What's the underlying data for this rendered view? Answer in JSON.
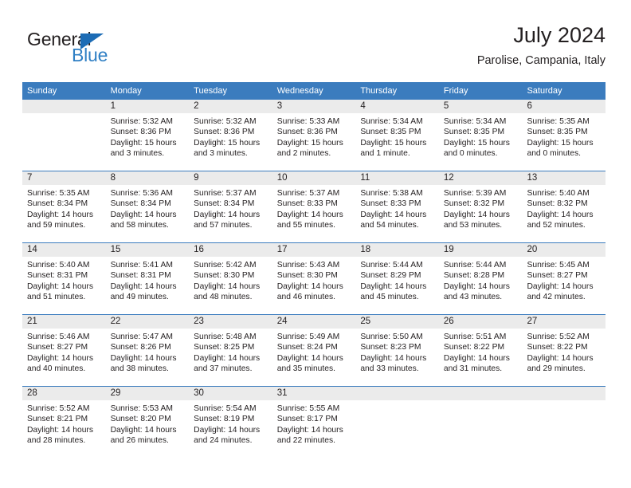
{
  "brand": {
    "name_top": "General",
    "name_bottom": "Blue",
    "accent_color": "#2f7fc4",
    "triangle_color": "#1c6cb5"
  },
  "header": {
    "title": "July 2024",
    "location": "Parolise, Campania, Italy"
  },
  "theme": {
    "header_blue": "#3b7cbe",
    "date_band_gray": "#ebebeb",
    "text_color": "#231f20"
  },
  "calendar": {
    "weekday_headers": [
      "Sunday",
      "Monday",
      "Tuesday",
      "Wednesday",
      "Thursday",
      "Friday",
      "Saturday"
    ],
    "weeks": [
      [
        {
          "day": "",
          "sunrise": "",
          "sunset": "",
          "daylight1": "",
          "daylight2": ""
        },
        {
          "day": "1",
          "sunrise": "Sunrise: 5:32 AM",
          "sunset": "Sunset: 8:36 PM",
          "daylight1": "Daylight: 15 hours",
          "daylight2": "and 3 minutes."
        },
        {
          "day": "2",
          "sunrise": "Sunrise: 5:32 AM",
          "sunset": "Sunset: 8:36 PM",
          "daylight1": "Daylight: 15 hours",
          "daylight2": "and 3 minutes."
        },
        {
          "day": "3",
          "sunrise": "Sunrise: 5:33 AM",
          "sunset": "Sunset: 8:36 PM",
          "daylight1": "Daylight: 15 hours",
          "daylight2": "and 2 minutes."
        },
        {
          "day": "4",
          "sunrise": "Sunrise: 5:34 AM",
          "sunset": "Sunset: 8:35 PM",
          "daylight1": "Daylight: 15 hours",
          "daylight2": "and 1 minute."
        },
        {
          "day": "5",
          "sunrise": "Sunrise: 5:34 AM",
          "sunset": "Sunset: 8:35 PM",
          "daylight1": "Daylight: 15 hours",
          "daylight2": "and 0 minutes."
        },
        {
          "day": "6",
          "sunrise": "Sunrise: 5:35 AM",
          "sunset": "Sunset: 8:35 PM",
          "daylight1": "Daylight: 15 hours",
          "daylight2": "and 0 minutes."
        }
      ],
      [
        {
          "day": "7",
          "sunrise": "Sunrise: 5:35 AM",
          "sunset": "Sunset: 8:34 PM",
          "daylight1": "Daylight: 14 hours",
          "daylight2": "and 59 minutes."
        },
        {
          "day": "8",
          "sunrise": "Sunrise: 5:36 AM",
          "sunset": "Sunset: 8:34 PM",
          "daylight1": "Daylight: 14 hours",
          "daylight2": "and 58 minutes."
        },
        {
          "day": "9",
          "sunrise": "Sunrise: 5:37 AM",
          "sunset": "Sunset: 8:34 PM",
          "daylight1": "Daylight: 14 hours",
          "daylight2": "and 57 minutes."
        },
        {
          "day": "10",
          "sunrise": "Sunrise: 5:37 AM",
          "sunset": "Sunset: 8:33 PM",
          "daylight1": "Daylight: 14 hours",
          "daylight2": "and 55 minutes."
        },
        {
          "day": "11",
          "sunrise": "Sunrise: 5:38 AM",
          "sunset": "Sunset: 8:33 PM",
          "daylight1": "Daylight: 14 hours",
          "daylight2": "and 54 minutes."
        },
        {
          "day": "12",
          "sunrise": "Sunrise: 5:39 AM",
          "sunset": "Sunset: 8:32 PM",
          "daylight1": "Daylight: 14 hours",
          "daylight2": "and 53 minutes."
        },
        {
          "day": "13",
          "sunrise": "Sunrise: 5:40 AM",
          "sunset": "Sunset: 8:32 PM",
          "daylight1": "Daylight: 14 hours",
          "daylight2": "and 52 minutes."
        }
      ],
      [
        {
          "day": "14",
          "sunrise": "Sunrise: 5:40 AM",
          "sunset": "Sunset: 8:31 PM",
          "daylight1": "Daylight: 14 hours",
          "daylight2": "and 51 minutes."
        },
        {
          "day": "15",
          "sunrise": "Sunrise: 5:41 AM",
          "sunset": "Sunset: 8:31 PM",
          "daylight1": "Daylight: 14 hours",
          "daylight2": "and 49 minutes."
        },
        {
          "day": "16",
          "sunrise": "Sunrise: 5:42 AM",
          "sunset": "Sunset: 8:30 PM",
          "daylight1": "Daylight: 14 hours",
          "daylight2": "and 48 minutes."
        },
        {
          "day": "17",
          "sunrise": "Sunrise: 5:43 AM",
          "sunset": "Sunset: 8:30 PM",
          "daylight1": "Daylight: 14 hours",
          "daylight2": "and 46 minutes."
        },
        {
          "day": "18",
          "sunrise": "Sunrise: 5:44 AM",
          "sunset": "Sunset: 8:29 PM",
          "daylight1": "Daylight: 14 hours",
          "daylight2": "and 45 minutes."
        },
        {
          "day": "19",
          "sunrise": "Sunrise: 5:44 AM",
          "sunset": "Sunset: 8:28 PM",
          "daylight1": "Daylight: 14 hours",
          "daylight2": "and 43 minutes."
        },
        {
          "day": "20",
          "sunrise": "Sunrise: 5:45 AM",
          "sunset": "Sunset: 8:27 PM",
          "daylight1": "Daylight: 14 hours",
          "daylight2": "and 42 minutes."
        }
      ],
      [
        {
          "day": "21",
          "sunrise": "Sunrise: 5:46 AM",
          "sunset": "Sunset: 8:27 PM",
          "daylight1": "Daylight: 14 hours",
          "daylight2": "and 40 minutes."
        },
        {
          "day": "22",
          "sunrise": "Sunrise: 5:47 AM",
          "sunset": "Sunset: 8:26 PM",
          "daylight1": "Daylight: 14 hours",
          "daylight2": "and 38 minutes."
        },
        {
          "day": "23",
          "sunrise": "Sunrise: 5:48 AM",
          "sunset": "Sunset: 8:25 PM",
          "daylight1": "Daylight: 14 hours",
          "daylight2": "and 37 minutes."
        },
        {
          "day": "24",
          "sunrise": "Sunrise: 5:49 AM",
          "sunset": "Sunset: 8:24 PM",
          "daylight1": "Daylight: 14 hours",
          "daylight2": "and 35 minutes."
        },
        {
          "day": "25",
          "sunrise": "Sunrise: 5:50 AM",
          "sunset": "Sunset: 8:23 PM",
          "daylight1": "Daylight: 14 hours",
          "daylight2": "and 33 minutes."
        },
        {
          "day": "26",
          "sunrise": "Sunrise: 5:51 AM",
          "sunset": "Sunset: 8:22 PM",
          "daylight1": "Daylight: 14 hours",
          "daylight2": "and 31 minutes."
        },
        {
          "day": "27",
          "sunrise": "Sunrise: 5:52 AM",
          "sunset": "Sunset: 8:22 PM",
          "daylight1": "Daylight: 14 hours",
          "daylight2": "and 29 minutes."
        }
      ],
      [
        {
          "day": "28",
          "sunrise": "Sunrise: 5:52 AM",
          "sunset": "Sunset: 8:21 PM",
          "daylight1": "Daylight: 14 hours",
          "daylight2": "and 28 minutes."
        },
        {
          "day": "29",
          "sunrise": "Sunrise: 5:53 AM",
          "sunset": "Sunset: 8:20 PM",
          "daylight1": "Daylight: 14 hours",
          "daylight2": "and 26 minutes."
        },
        {
          "day": "30",
          "sunrise": "Sunrise: 5:54 AM",
          "sunset": "Sunset: 8:19 PM",
          "daylight1": "Daylight: 14 hours",
          "daylight2": "and 24 minutes."
        },
        {
          "day": "31",
          "sunrise": "Sunrise: 5:55 AM",
          "sunset": "Sunset: 8:17 PM",
          "daylight1": "Daylight: 14 hours",
          "daylight2": "and 22 minutes."
        },
        {
          "day": "",
          "sunrise": "",
          "sunset": "",
          "daylight1": "",
          "daylight2": ""
        },
        {
          "day": "",
          "sunrise": "",
          "sunset": "",
          "daylight1": "",
          "daylight2": ""
        },
        {
          "day": "",
          "sunrise": "",
          "sunset": "",
          "daylight1": "",
          "daylight2": ""
        }
      ]
    ]
  }
}
